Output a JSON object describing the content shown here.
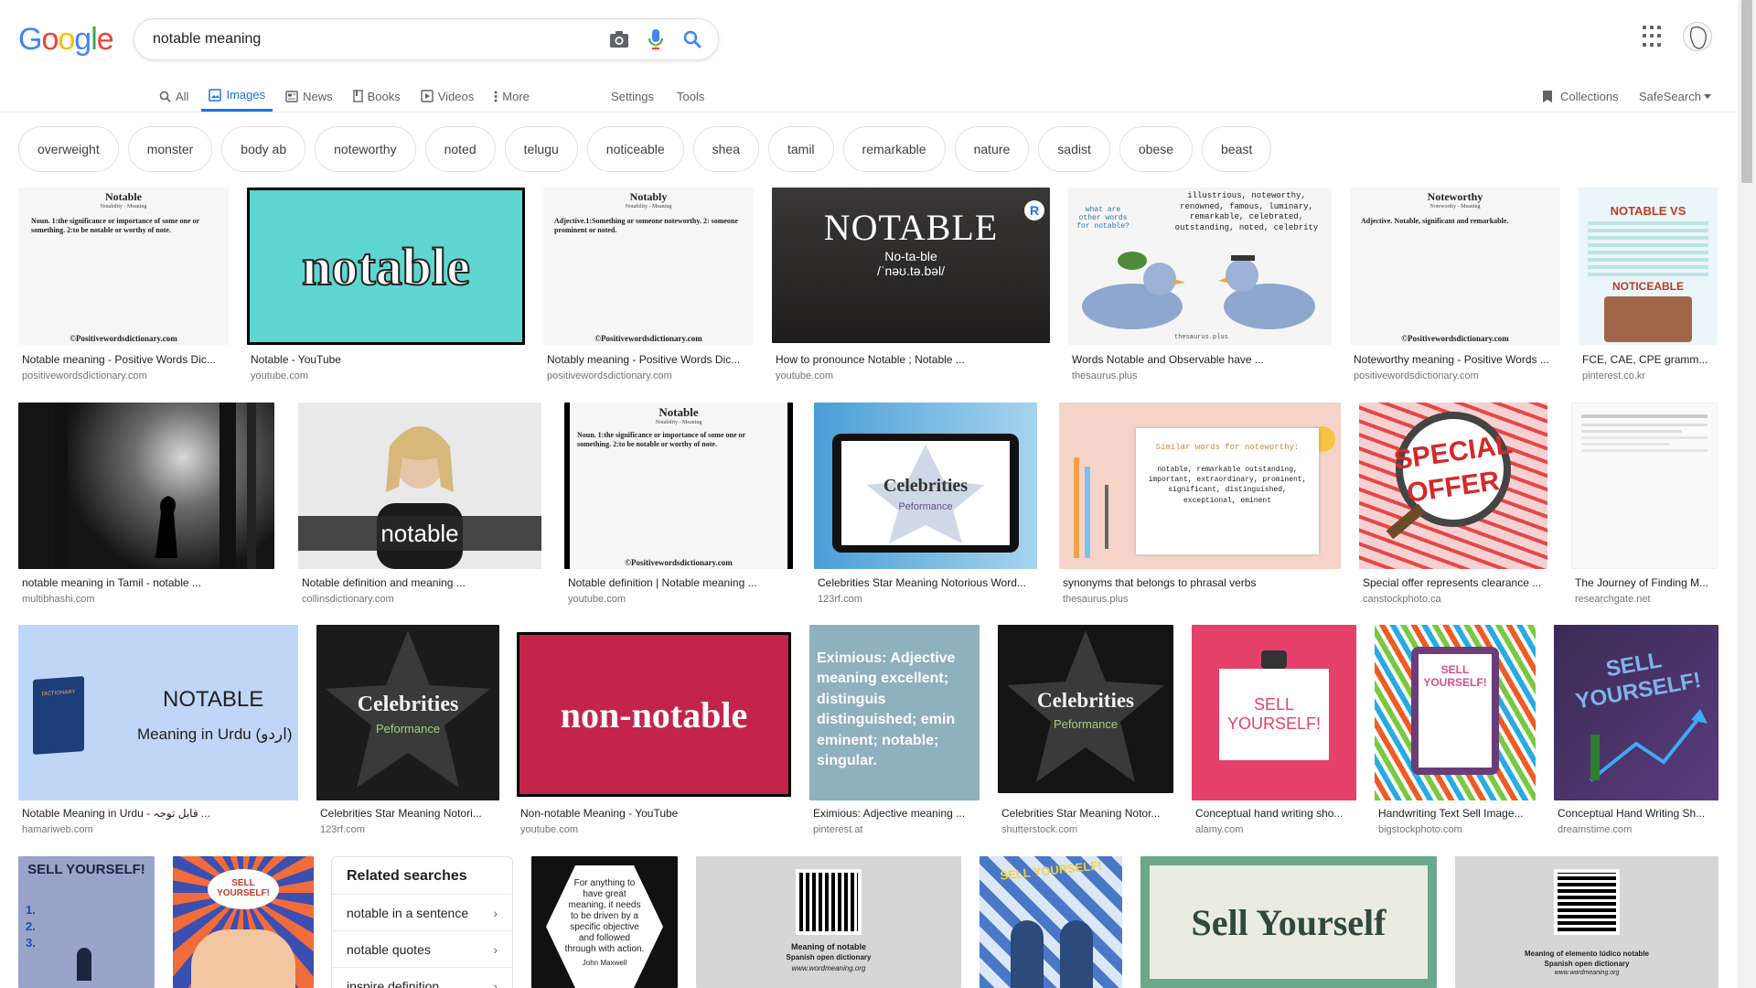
{
  "logo": {
    "text": "Google",
    "colors": [
      "#4285F4",
      "#EA4335",
      "#FBBC05",
      "#4285F4",
      "#34A853",
      "#EA4335"
    ]
  },
  "search": {
    "query": "notable meaning"
  },
  "icons": {
    "camera": "camera-icon",
    "mic": "mic-icon",
    "search": "search-icon",
    "apps": "apps-grid-icon"
  },
  "tabs": [
    {
      "label": "All",
      "icon": "search-icon"
    },
    {
      "label": "Images",
      "icon": "image-icon"
    },
    {
      "label": "News",
      "icon": "news-icon"
    },
    {
      "label": "Books",
      "icon": "book-icon"
    },
    {
      "label": "Videos",
      "icon": "video-icon"
    },
    {
      "label": "More",
      "icon": "more-icon"
    }
  ],
  "tools": {
    "settings": "Settings",
    "tools": "Tools",
    "collections": "Collections",
    "safesearch": "SafeSearch"
  },
  "chips": [
    "overweight",
    "monster",
    "body ab",
    "noteworthy",
    "noted",
    "telugu",
    "noticeable",
    "shea",
    "tamil",
    "remarkable",
    "nature",
    "sadist",
    "obese",
    "beast"
  ],
  "results_row1": [
    {
      "caption": "Notable meaning - Positive Words Dic...",
      "source": "positivewordsdictionary.com",
      "img_title": "Notable",
      "img_sub": "Notability - Meaning",
      "img_body": "Noun. 1:the significance or importance of some one or something. 2:to be notable or worthy of note.",
      "img_foot": "©Positivewordsdictionary.com"
    },
    {
      "caption": "Notable - YouTube",
      "source": "youtube.com",
      "img_word": "notable"
    },
    {
      "caption": "Notably meaning - Positive Words Dic...",
      "source": "positivewordsdictionary.com",
      "img_title": "Notably",
      "img_sub": "Notability - Meaning",
      "img_body": "Adjective.1:Something or someone noteworthy. 2: someone prominent or noted.",
      "img_foot": "©Positivewordsdictionary.com"
    },
    {
      "caption": "How to pronounce Notable ; Notable ...",
      "source": "youtube.com",
      "img_word": "NOTABLE",
      "img_sub": "No-ta-ble",
      "img_ipa": "/ˈnəʊ.tə.bəl/"
    },
    {
      "caption": "Words Notable and Observable have ...",
      "source": "thesaurus.plus",
      "img_q": "what are other words for notable?",
      "img_list": "illustrious, noteworthy, renowned, famous, luminary, remarkable, celebrated, outstanding, noted, celebrity",
      "img_foot": "thesaurus.plus"
    },
    {
      "caption": "Noteworthy meaning - Positive Words ...",
      "source": "positivewordsdictionary.com",
      "img_title": "Noteworthy",
      "img_sub": "Noteworthy - Meaning",
      "img_body": "Adjective. Notable, significant and remarkable.",
      "img_foot": "©Positivewordsdictionary.com"
    },
    {
      "caption": "FCE, CAE, CPE gramm...",
      "source": "pinterest.co.kr",
      "img_a": "NOTABLE VS",
      "img_b": "NOTICEABLE"
    }
  ],
  "results_row2": [
    {
      "caption": "notable meaning in Tamil - notable ...",
      "source": "multibhashi.com"
    },
    {
      "caption": "Notable definition and meaning ...",
      "source": "collinsdictionary.com",
      "img_word": "notable"
    },
    {
      "caption": "Notable definition | Notable meaning ...",
      "source": "youtube.com",
      "img_title": "Notable",
      "img_sub": "Notability - Meaning",
      "img_body": "Noun. 1:the significance or importance of some one or something. 2:to be notable or worthy of note.",
      "img_foot": "©Positivewordsdictionary.com"
    },
    {
      "caption": "Celebrities Star Meaning Notorious Word...",
      "source": "123rf.com",
      "img_word": "Celebrities",
      "img_sub": "Peformance"
    },
    {
      "caption": "synonyms that belongs to phrasal verbs",
      "source": "thesaurus.plus",
      "img_head": "Similar words for noteworthy:",
      "img_list": "notable, remarkable outstanding, important, extraordinary, prominent, significant, distinguished, exceptional, eminent"
    },
    {
      "caption": "Special offer represents clearance ...",
      "source": "canstockphoto.ca",
      "img_a": "SPECIAL",
      "img_b": "OFFER"
    },
    {
      "caption": "The Journey of Finding M...",
      "source": "researchgate.net"
    }
  ],
  "results_row3": [
    {
      "caption": "Notable Meaning in Urdu - قابل توجہ ...",
      "source": "hamariweb.com",
      "img_word": "NOTABLE",
      "img_sub": "Meaning in Urdu (اردو)",
      "img_book": "DICTIONARY"
    },
    {
      "caption": "Celebrities Star Meaning Notori...",
      "source": "123rf.com",
      "img_word": "Celebrities",
      "img_sub": "Peformance"
    },
    {
      "caption": "Non-notable Meaning - YouTube",
      "source": "youtube.com",
      "img_word": "non-notable"
    },
    {
      "caption": "Eximious: Adjective meaning ...",
      "source": "pinterest.at",
      "img_text": "Eximious: Adjective meaning excellent; distinguis distinguished; emin eminent; notable; singular."
    },
    {
      "caption": "Celebrities Star Meaning Notor...",
      "source": "shutterstock.com",
      "img_word": "Celebrities",
      "img_sub": "Peformance"
    },
    {
      "caption": "Conceptual hand writing sho...",
      "source": "alamy.com",
      "img_word": "SELL YOURSELF!"
    },
    {
      "caption": "Handwriting Text Sell Image...",
      "source": "bigstockphoto.com",
      "img_word": "SELL YOURSELF!"
    },
    {
      "caption": "Conceptual Hand Writing Sh...",
      "source": "dreamstime.com",
      "img_word": "SELL YOURSELF!"
    }
  ],
  "results_row4": [
    {
      "img_word": "SELL YOURSELF!",
      "img_list": "1. 2. 3."
    },
    {
      "img_word": "SELL YOURSELF!"
    },
    {
      "img_quote": "For anything to have great meaning, it needs to be driven by a specific objective and followed through with action.",
      "img_author": "John Maxwell"
    },
    {
      "img_title": "Meaning of notable",
      "img_sub": "Spanish open dictionary",
      "img_foot": "www.wordmeaning.org"
    },
    {
      "img_word": "SELL YOURSELF!"
    },
    {
      "img_word": "Sell Yourself"
    },
    {
      "img_title": "Meaning of elemento lúdico notable",
      "img_sub": "Spanish open dictionary",
      "img_foot": "www.wordmeaning.org"
    }
  ],
  "related": {
    "title": "Related searches",
    "items": [
      "notable in a sentence",
      "notable quotes",
      "inspire definition"
    ]
  }
}
